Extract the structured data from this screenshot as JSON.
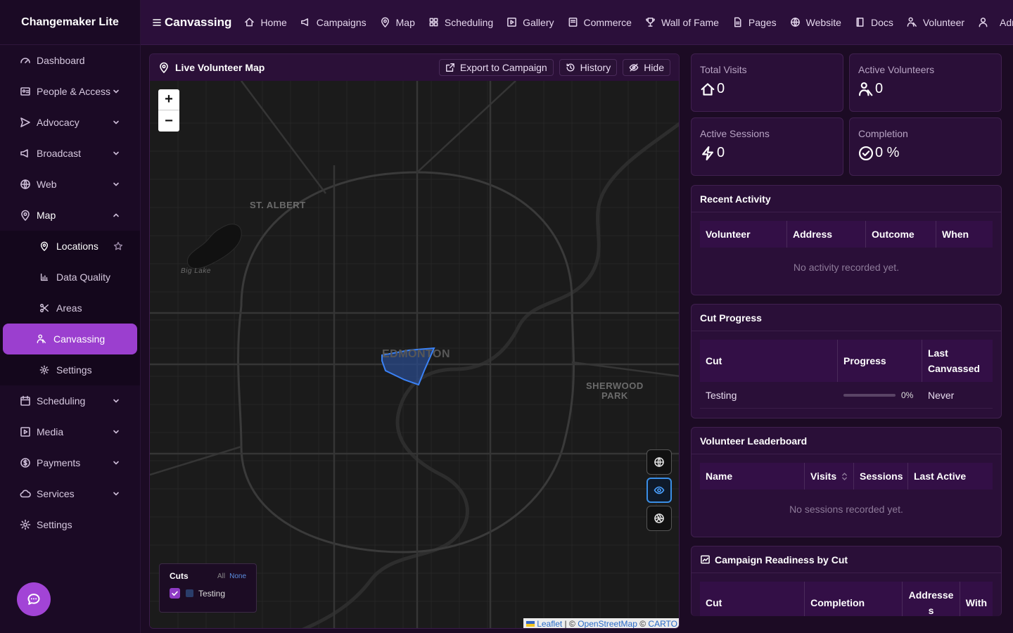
{
  "app": {
    "name": "Changemaker Lite"
  },
  "sidebar": {
    "items": [
      {
        "label": "Dashboard"
      },
      {
        "label": "People & Access"
      },
      {
        "label": "Advocacy"
      },
      {
        "label": "Broadcast"
      },
      {
        "label": "Web"
      },
      {
        "label": "Map"
      },
      {
        "label": "Scheduling"
      },
      {
        "label": "Media"
      },
      {
        "label": "Payments"
      },
      {
        "label": "Services"
      },
      {
        "label": "Settings"
      }
    ],
    "map_sub": [
      {
        "label": "Locations"
      },
      {
        "label": "Data Quality"
      },
      {
        "label": "Areas"
      },
      {
        "label": "Canvassing"
      },
      {
        "label": "Settings"
      }
    ]
  },
  "topbar": {
    "title": "Canvassing",
    "links": [
      "Home",
      "Campaigns",
      "Map",
      "Scheduling",
      "Gallery",
      "Commerce",
      "Wall of Fame",
      "Pages",
      "Website",
      "Docs",
      "Volunteer",
      "Adm"
    ]
  },
  "map_card": {
    "title": "Live Volunteer Map",
    "export_label": "Export to Campaign",
    "history_label": "History",
    "hide_label": "Hide",
    "zoom_in": "+",
    "zoom_out": "−",
    "places": {
      "st_albert": "ST. ALBERT",
      "big_lake": "Big Lake",
      "edmonton": "EDMONTON",
      "sherwood_1": "SHERWOOD",
      "sherwood_2": "PARK"
    },
    "cuts": {
      "title": "Cuts",
      "all": "All",
      "none": "None",
      "item": "Testing",
      "item_checked": true
    },
    "attribution": {
      "leaflet": "Leaflet",
      "sep": " | © ",
      "osm": "OpenStreetMap",
      "sep2": " © ",
      "carto": "CARTO"
    }
  },
  "stats": {
    "total_visits": {
      "label": "Total Visits",
      "value": "0"
    },
    "active_volunteers": {
      "label": "Active Volunteers",
      "value": "0"
    },
    "active_sessions": {
      "label": "Active Sessions",
      "value": "0"
    },
    "completion": {
      "label": "Completion",
      "value": "0 %"
    }
  },
  "recent_activity": {
    "title": "Recent Activity",
    "columns": [
      "Volunteer",
      "Address",
      "Outcome",
      "When"
    ],
    "empty": "No activity recorded yet."
  },
  "cut_progress": {
    "title": "Cut Progress",
    "columns": [
      "Cut",
      "Progress",
      "Last Canvassed"
    ],
    "rows": [
      {
        "cut": "Testing",
        "progress": 0,
        "progress_label": "0%",
        "last": "Never"
      }
    ]
  },
  "leaderboard": {
    "title": "Volunteer Leaderboard",
    "columns": [
      "Name",
      "Visits",
      "Sessions",
      "Last Active"
    ],
    "empty": "No sessions recorded yet."
  },
  "readiness": {
    "title": "Campaign Readiness by Cut",
    "columns": [
      "Cut",
      "Completion",
      "Addresses",
      "With"
    ]
  },
  "colors": {
    "accent": "#9b3fcf",
    "cut_fill": "#2a4a8a",
    "cut_stroke": "#3b82f6"
  }
}
